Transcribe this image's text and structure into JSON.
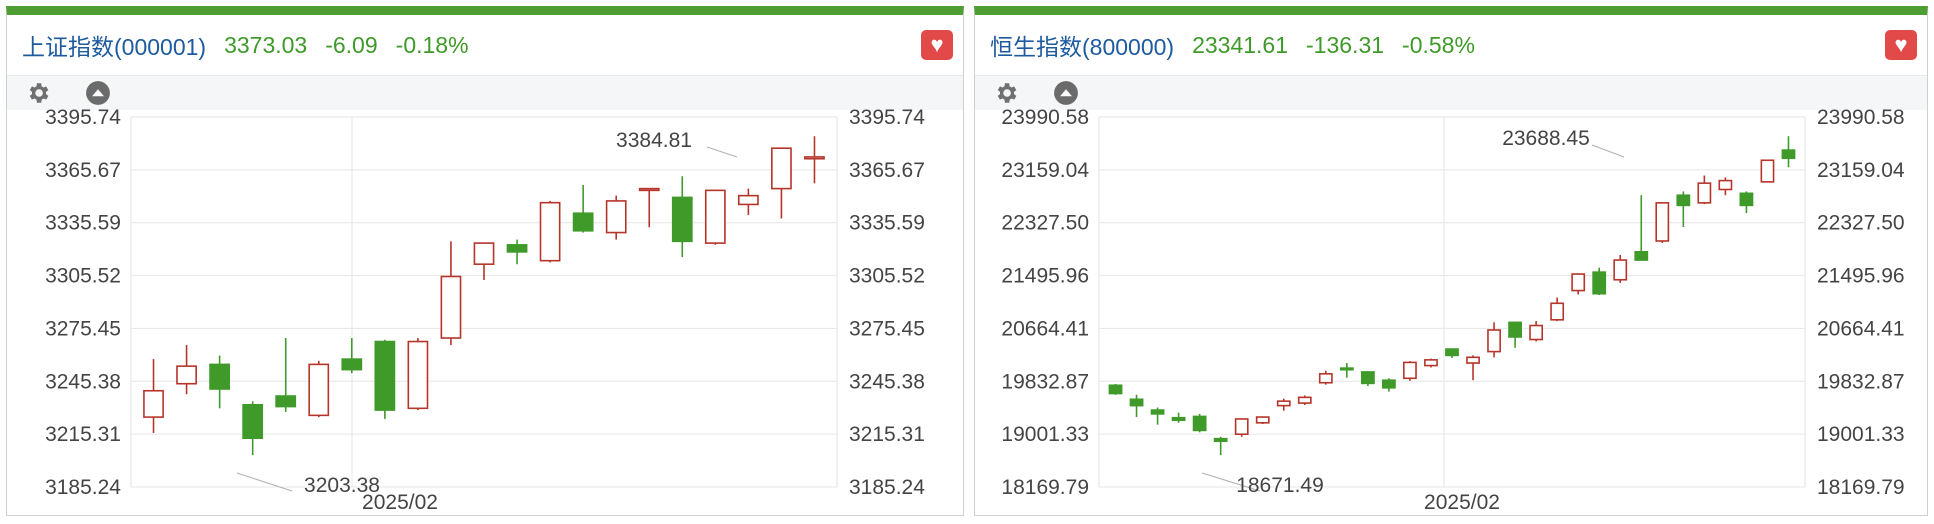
{
  "colors": {
    "up": "#b5352a",
    "down": "#3f9a2a",
    "header_name": "#1e5a9e",
    "header_value": "#3f9a2a",
    "accent_bar": "#4f9e34",
    "grid": "#e6e6e6"
  },
  "icons": {
    "settings": "gear-icon",
    "collapse": "chevron-up-circle-icon",
    "favorite": "heart-icon"
  },
  "chart_data": [
    {
      "type": "candlestick",
      "name": "上证指数(000001)",
      "last": "3373.03",
      "change": "-6.09",
      "change_pct": "-0.18%",
      "x_label": "2025/02",
      "yticks": [
        "3395.74",
        "3365.67",
        "3335.59",
        "3305.52",
        "3275.45",
        "3245.38",
        "3215.31",
        "3185.24"
      ],
      "ylim": [
        3185.24,
        3395.74
      ],
      "max_label": "3384.81",
      "min_label": "3203.38",
      "candles": [
        {
          "o": 3225,
          "h": 3258,
          "l": 3216,
          "c": 3240
        },
        {
          "o": 3244,
          "h": 3266,
          "l": 3238,
          "c": 3254
        },
        {
          "o": 3255,
          "h": 3260,
          "l": 3230,
          "c": 3241
        },
        {
          "o": 3232,
          "h": 3234,
          "l": 3203.38,
          "c": 3213
        },
        {
          "o": 3237,
          "h": 3270,
          "l": 3228,
          "c": 3231
        },
        {
          "o": 3226,
          "h": 3257,
          "l": 3225,
          "c": 3255
        },
        {
          "o": 3258,
          "h": 3270,
          "l": 3250,
          "c": 3252
        },
        {
          "o": 3268,
          "h": 3269,
          "l": 3224,
          "c": 3229
        },
        {
          "o": 3230,
          "h": 3270,
          "l": 3229,
          "c": 3268
        },
        {
          "o": 3270,
          "h": 3325,
          "l": 3266,
          "c": 3305
        },
        {
          "o": 3312,
          "h": 3322,
          "l": 3303,
          "c": 3324
        },
        {
          "o": 3323,
          "h": 3326,
          "l": 3312,
          "c": 3319
        },
        {
          "o": 3314,
          "h": 3348,
          "l": 3313,
          "c": 3347
        },
        {
          "o": 3341,
          "h": 3357,
          "l": 3330,
          "c": 3331
        },
        {
          "o": 3330,
          "h": 3351,
          "l": 3326,
          "c": 3348
        },
        {
          "o": 3354,
          "h": 3355,
          "l": 3333,
          "c": 3355
        },
        {
          "o": 3350,
          "h": 3362,
          "l": 3316,
          "c": 3325
        },
        {
          "o": 3324,
          "h": 3354,
          "l": 3323,
          "c": 3354
        },
        {
          "o": 3346,
          "h": 3355,
          "l": 3340,
          "c": 3351
        },
        {
          "o": 3355,
          "h": 3378,
          "l": 3338,
          "c": 3378
        },
        {
          "o": 3372,
          "h": 3384.81,
          "l": 3358,
          "c": 3373.03
        }
      ]
    },
    {
      "type": "candlestick",
      "name": "恒生指数(800000)",
      "last": "23341.61",
      "change": "-136.31",
      "change_pct": "-0.58%",
      "x_label": "2025/02",
      "yticks": [
        "23990.58",
        "23159.04",
        "22327.50",
        "21495.96",
        "20664.41",
        "19832.87",
        "19001.33",
        "18169.79"
      ],
      "ylim": [
        18169.79,
        23990.58
      ],
      "max_label": "23688.45",
      "min_label": "18671.49",
      "candles": [
        {
          "o": 19770,
          "h": 19790,
          "l": 19620,
          "c": 19640
        },
        {
          "o": 19550,
          "h": 19620,
          "l": 19270,
          "c": 19450
        },
        {
          "o": 19380,
          "h": 19420,
          "l": 19150,
          "c": 19320
        },
        {
          "o": 19260,
          "h": 19340,
          "l": 19180,
          "c": 19220
        },
        {
          "o": 19280,
          "h": 19320,
          "l": 19030,
          "c": 19060
        },
        {
          "o": 18930,
          "h": 18960,
          "l": 18671.49,
          "c": 18890
        },
        {
          "o": 19000,
          "h": 19250,
          "l": 18960,
          "c": 19240
        },
        {
          "o": 19180,
          "h": 19280,
          "l": 19160,
          "c": 19270
        },
        {
          "o": 19450,
          "h": 19560,
          "l": 19370,
          "c": 19520
        },
        {
          "o": 19490,
          "h": 19610,
          "l": 19460,
          "c": 19580
        },
        {
          "o": 19810,
          "h": 20000,
          "l": 19780,
          "c": 19950
        },
        {
          "o": 20040,
          "h": 20120,
          "l": 19890,
          "c": 20030
        },
        {
          "o": 19980,
          "h": 19990,
          "l": 19760,
          "c": 19800
        },
        {
          "o": 19850,
          "h": 19880,
          "l": 19670,
          "c": 19730
        },
        {
          "o": 19880,
          "h": 20150,
          "l": 19840,
          "c": 20130
        },
        {
          "o": 20080,
          "h": 20190,
          "l": 20050,
          "c": 20170
        },
        {
          "o": 20340,
          "h": 20350,
          "l": 20200,
          "c": 20240
        },
        {
          "o": 20120,
          "h": 20240,
          "l": 19850,
          "c": 20210
        },
        {
          "o": 20300,
          "h": 20760,
          "l": 20210,
          "c": 20640
        },
        {
          "o": 20760,
          "h": 20770,
          "l": 20360,
          "c": 20530
        },
        {
          "o": 20490,
          "h": 20780,
          "l": 20460,
          "c": 20710
        },
        {
          "o": 20800,
          "h": 21150,
          "l": 20780,
          "c": 21060
        },
        {
          "o": 21260,
          "h": 21530,
          "l": 21200,
          "c": 21520
        },
        {
          "o": 21550,
          "h": 21620,
          "l": 21190,
          "c": 21210
        },
        {
          "o": 21430,
          "h": 21820,
          "l": 21380,
          "c": 21740
        },
        {
          "o": 21870,
          "h": 22760,
          "l": 21820,
          "c": 21740
        },
        {
          "o": 22040,
          "h": 22640,
          "l": 22010,
          "c": 22640
        },
        {
          "o": 22760,
          "h": 22820,
          "l": 22260,
          "c": 22600
        },
        {
          "o": 22640,
          "h": 23070,
          "l": 22620,
          "c": 22950
        },
        {
          "o": 22850,
          "h": 23040,
          "l": 22760,
          "c": 22990
        },
        {
          "o": 22790,
          "h": 22820,
          "l": 22480,
          "c": 22600
        },
        {
          "o": 22970,
          "h": 23320,
          "l": 22960,
          "c": 23310
        },
        {
          "o": 23470,
          "h": 23688.45,
          "l": 23200,
          "c": 23341.61
        }
      ]
    }
  ]
}
